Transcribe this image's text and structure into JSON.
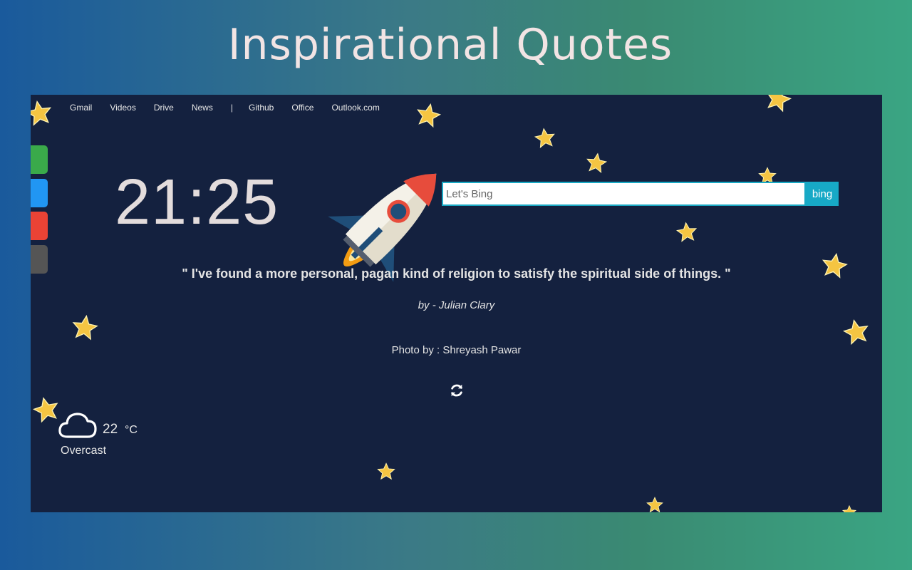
{
  "banner": {
    "title": "Inspirational Quotes"
  },
  "topnav": {
    "items": [
      "Gmail",
      "Videos",
      "Drive",
      "News",
      "|",
      "Github",
      "Office",
      "Outlook.com"
    ]
  },
  "side_tabs": {
    "colors": [
      "#3aaa4a",
      "#2196f3",
      "#ea4335",
      "#555555"
    ]
  },
  "clock": {
    "time": "21:25"
  },
  "search": {
    "placeholder": "Let's Bing",
    "button_label": "bing"
  },
  "quote": {
    "text": "\" I've found a more personal, pagan kind of religion to satisfy the spiritual side of things. \"",
    "author": "by - Julian Clary"
  },
  "photo": {
    "credit": "Photo by : Shreyash Pawar"
  },
  "refresh": {
    "icon": "refresh-icon"
  },
  "weather": {
    "icon": "cloud-icon",
    "temperature": "22",
    "unit": "°C",
    "condition": "Overcast"
  },
  "colors": {
    "screen_bg": "#14213f",
    "search_accent": "#17a9c6",
    "star": "#f5c542"
  }
}
